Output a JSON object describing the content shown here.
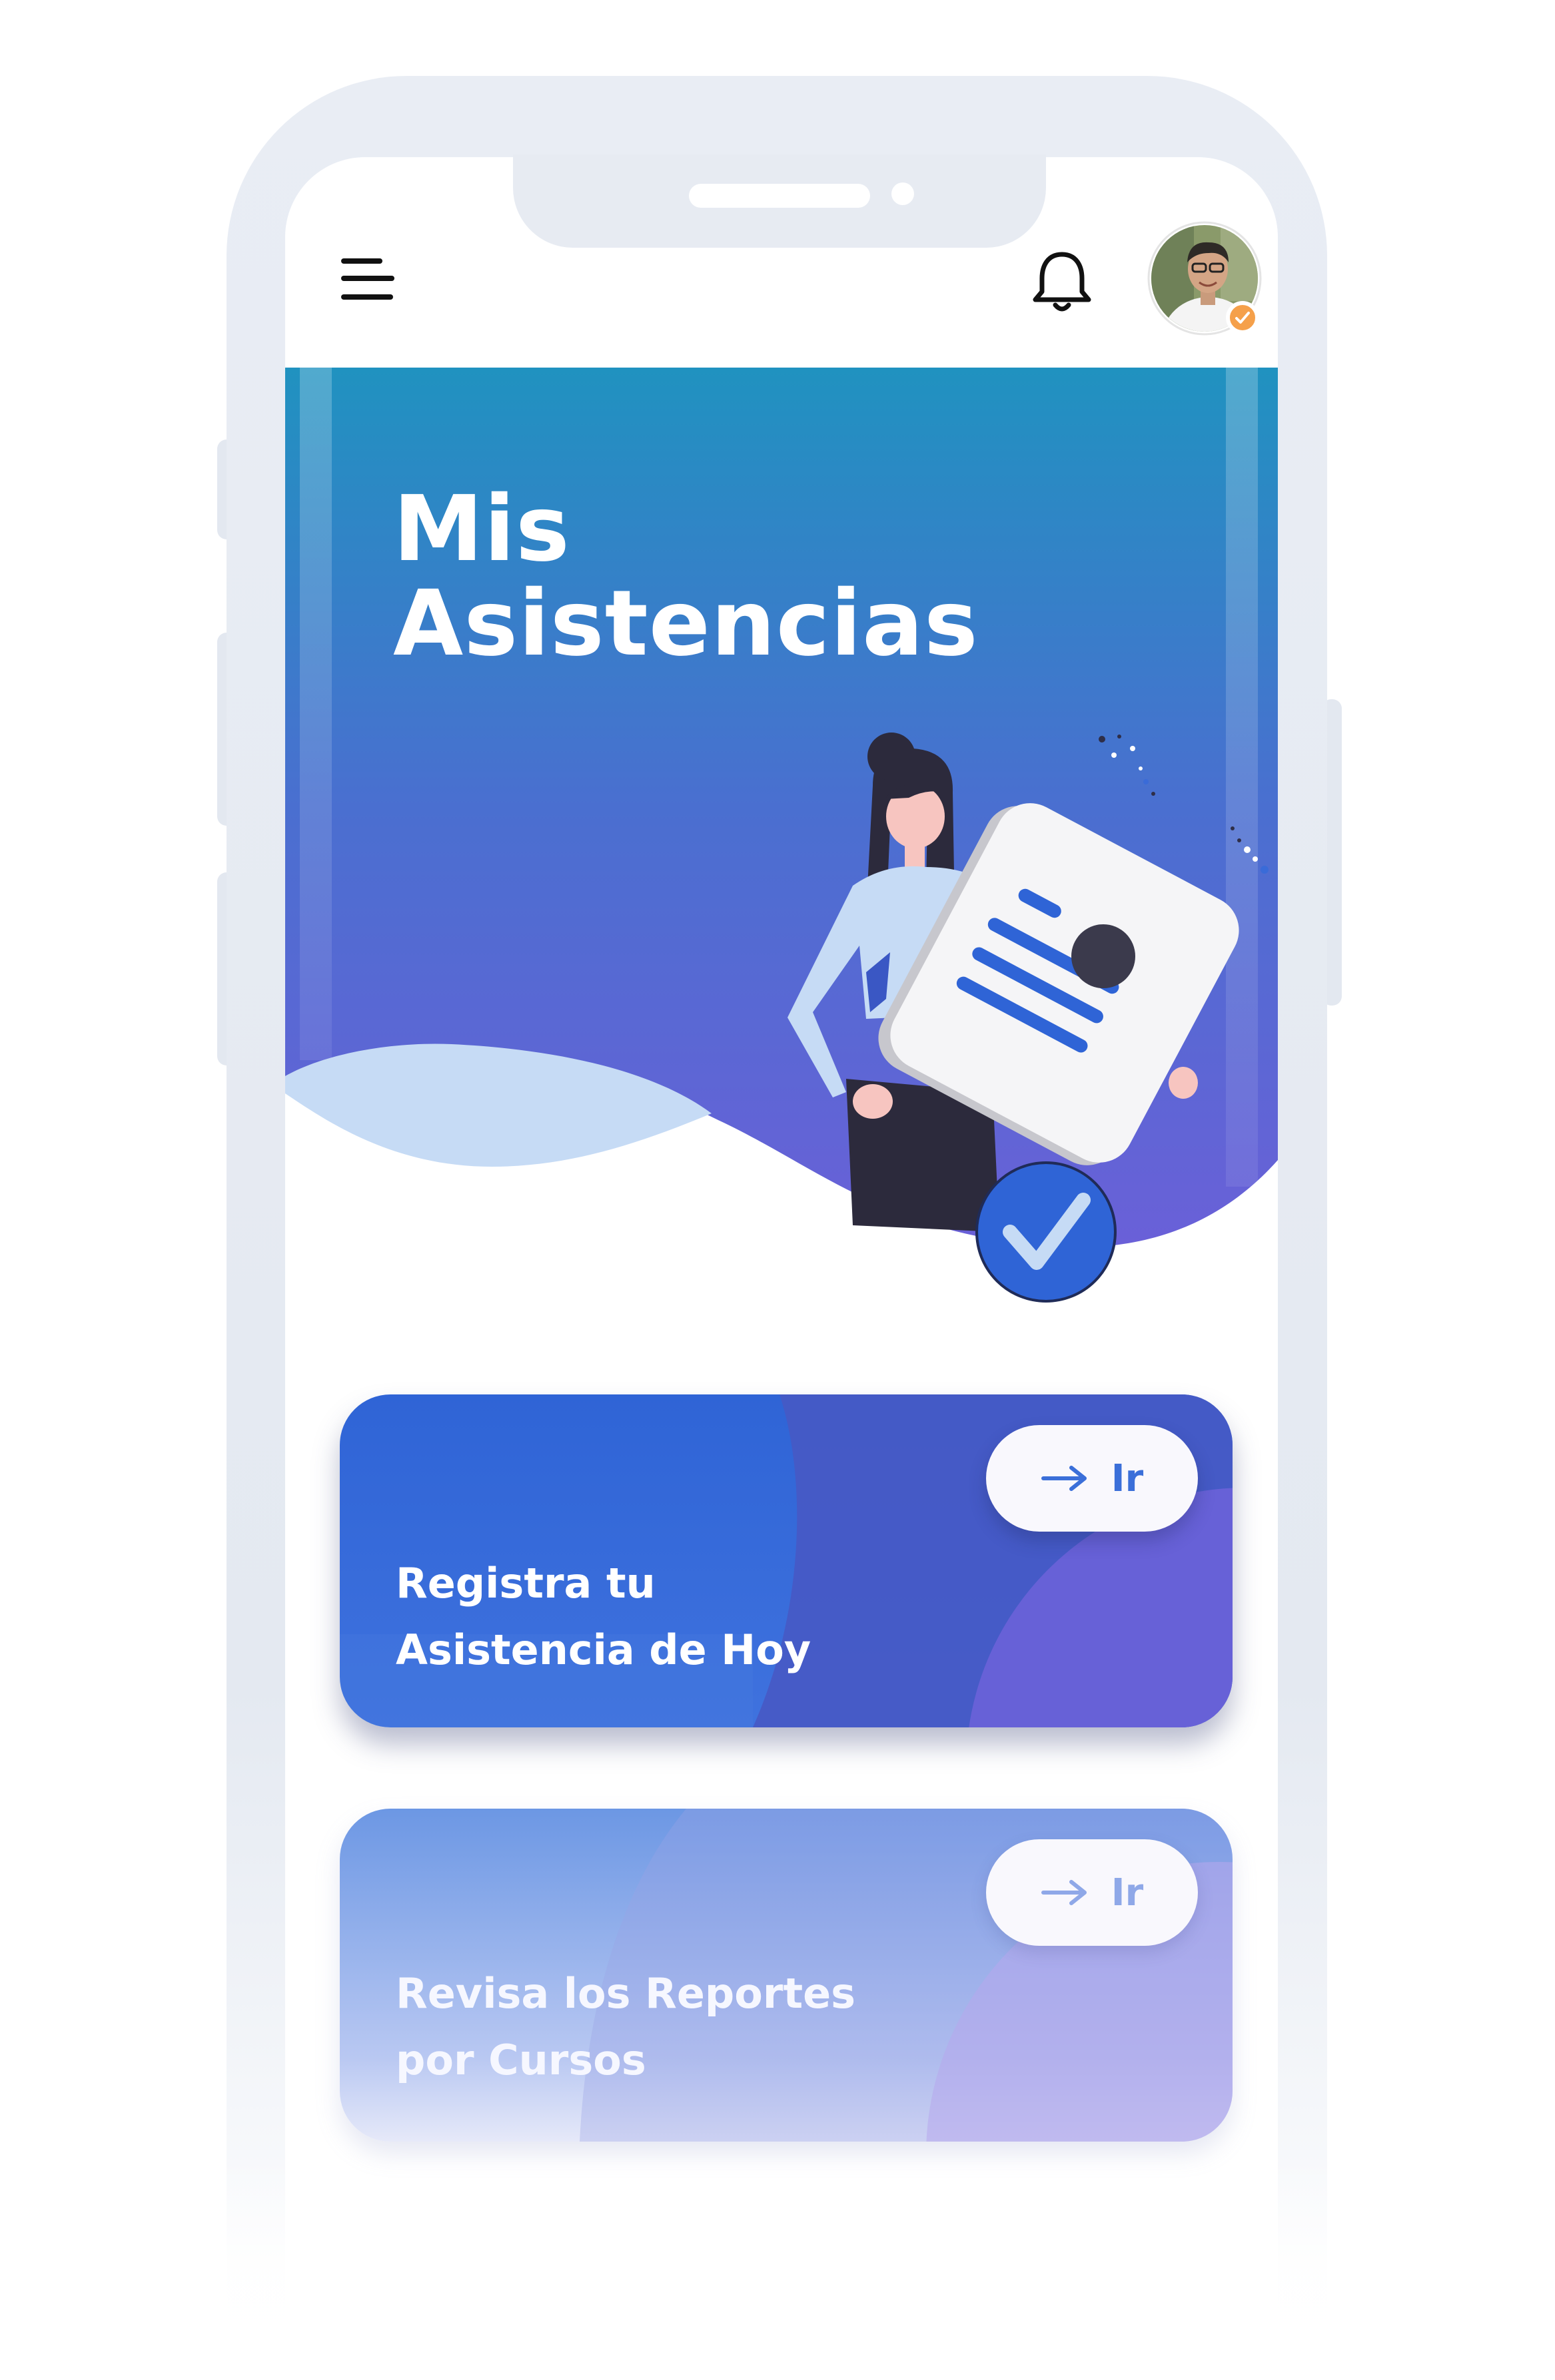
{
  "header": {
    "menu_icon": "menu-icon",
    "notification_icon": "bell-icon",
    "avatar": {
      "icon": "user-avatar",
      "badge": "verified-check-badge",
      "badge_color": "#f5a04a"
    }
  },
  "hero": {
    "title_line1": "Mis",
    "title_line2": "Asistencias",
    "gradient_top": "#2092c0",
    "gradient_bottom": "#6262d6",
    "illustration": "woman-holding-document-with-checkmark"
  },
  "cards": [
    {
      "line1": "Registra tu",
      "line2": "Asistencia de Hoy",
      "button_label": "Ir",
      "button_icon": "arrow-right-icon",
      "color": "#2f64d6"
    },
    {
      "line1": "Revisa los Reportes",
      "line2": "por Cursos",
      "button_label": "Ir",
      "button_icon": "arrow-right-icon",
      "color": "#7a9ce6"
    }
  ]
}
